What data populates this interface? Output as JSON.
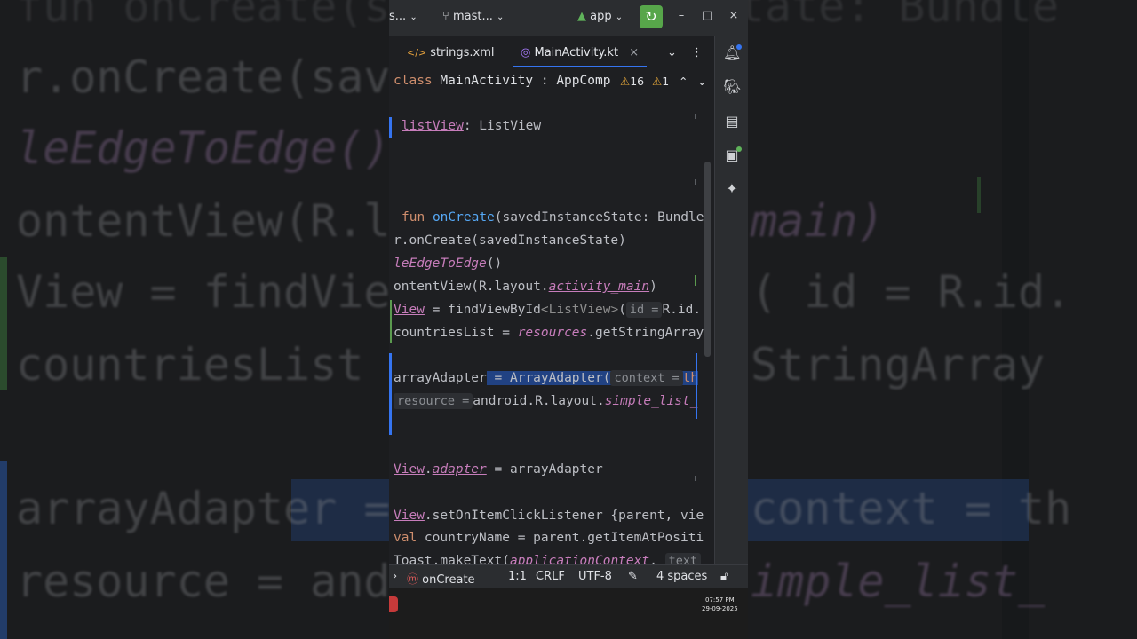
{
  "toolbar": {
    "project": "s...",
    "branch": "mast...",
    "run_config": "app",
    "minimize": "–",
    "maximize": "□",
    "close": "×"
  },
  "tabs": [
    {
      "label": "strings.xml",
      "active": false
    },
    {
      "label": "MainActivity.kt",
      "active": true
    }
  ],
  "tab_close": "×",
  "breadcrumb": {
    "keyword": "class",
    "text": " MainActivity : AppComp",
    "warnings": "16",
    "weak_warnings": "1"
  },
  "code": {
    "l1_a": "listView",
    "l1_b": ": ListView",
    "l2_kw": "fun",
    "l2_fn": "onCreate",
    "l2_rest": "(savedInstanceState: Bundle",
    "l3": "r.onCreate(savedInstanceState)",
    "l4_a": "leEdgeToEdge",
    "l4_b": "()",
    "l5_a": "ontentView(R.layout.",
    "l5_b": "activity_main",
    "l5_c": ")",
    "l6_a": "View",
    "l6_b": " = findViewById",
    "l6_c": "<ListView>",
    "l6_d": "(",
    "l6_hint": "id =",
    "l6_e": "R.id.",
    "l7_a": "countriesList = ",
    "l7_b": "resources",
    "l7_c": ".getStringArray",
    "l8_a": "arrayAdapter",
    "l8_b": " = ArrayAdapter(",
    "l8_hint": "context =",
    "l8_c": "th",
    "l9_hint": "resource =",
    "l9_a": "android.R.layout.",
    "l9_b": "simple_list_",
    "l10_a": "View",
    "l10_b": ".",
    "l10_c": "adapter",
    "l10_d": " = arrayAdapter",
    "l11_a": "View",
    "l11_b": ".setOnItemClickListener {parent, vie",
    "l12_kw": "val",
    "l12_b": " countryName = parent.getItemAtPositi",
    "l13_a": "Toast.",
    "l13_b": "makeText(",
    "l13_c": "applicationContext",
    "l13_d": ",",
    "l13_hint": "text"
  },
  "statusbar": {
    "function": "onCreate",
    "position": "1:1",
    "line_sep": "CRLF",
    "encoding": "UTF-8",
    "indent": "4 spaces"
  },
  "taskbar": {
    "time": "07:57 PM",
    "date": "29-09-2025"
  },
  "background": {
    "line1": "fun onCreate(savedInstanceState: Bundle",
    "line2": "r.onCreate(save",
    "line3": "leEdgeToEdge()",
    "line4": "ontentView(R.la",
    "line4b": "main)",
    "line5": "View = findView",
    "line5b": "( id = R.id.",
    "line6": "countriesList =",
    "line6b": "StringArray",
    "line7": "arrayAdapter =",
    "line7b": "context = th",
    "line8": "resource = andr",
    "line8b": "imple_list_"
  }
}
